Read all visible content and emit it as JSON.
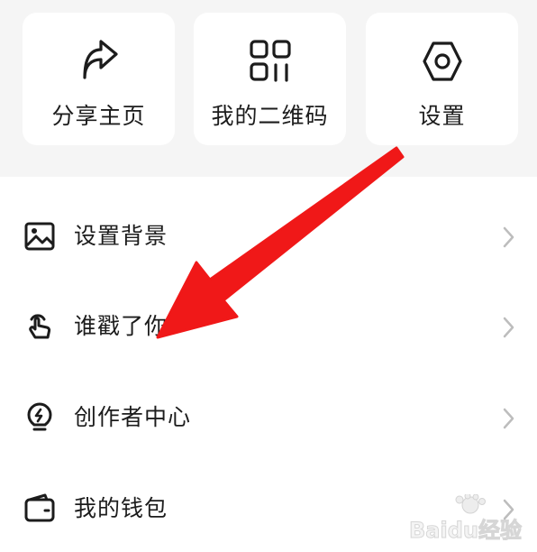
{
  "quick_actions": [
    {
      "label": "分享主页",
      "icon": "share-icon"
    },
    {
      "label": "我的二维码",
      "icon": "qrcode-icon"
    },
    {
      "label": "设置",
      "icon": "settings-icon"
    }
  ],
  "menu": [
    {
      "label": "设置背景",
      "icon": "image-icon"
    },
    {
      "label": "谁戳了你",
      "icon": "tap-hand-icon"
    },
    {
      "label": "创作者中心",
      "icon": "lightbulb-icon"
    },
    {
      "label": "我的钱包",
      "icon": "wallet-icon"
    }
  ],
  "watermark": {
    "text": "Baidu经验"
  },
  "colors": {
    "annotation_arrow": "#f01818",
    "text": "#1c1c1c",
    "chevron": "#bdbdbd"
  }
}
